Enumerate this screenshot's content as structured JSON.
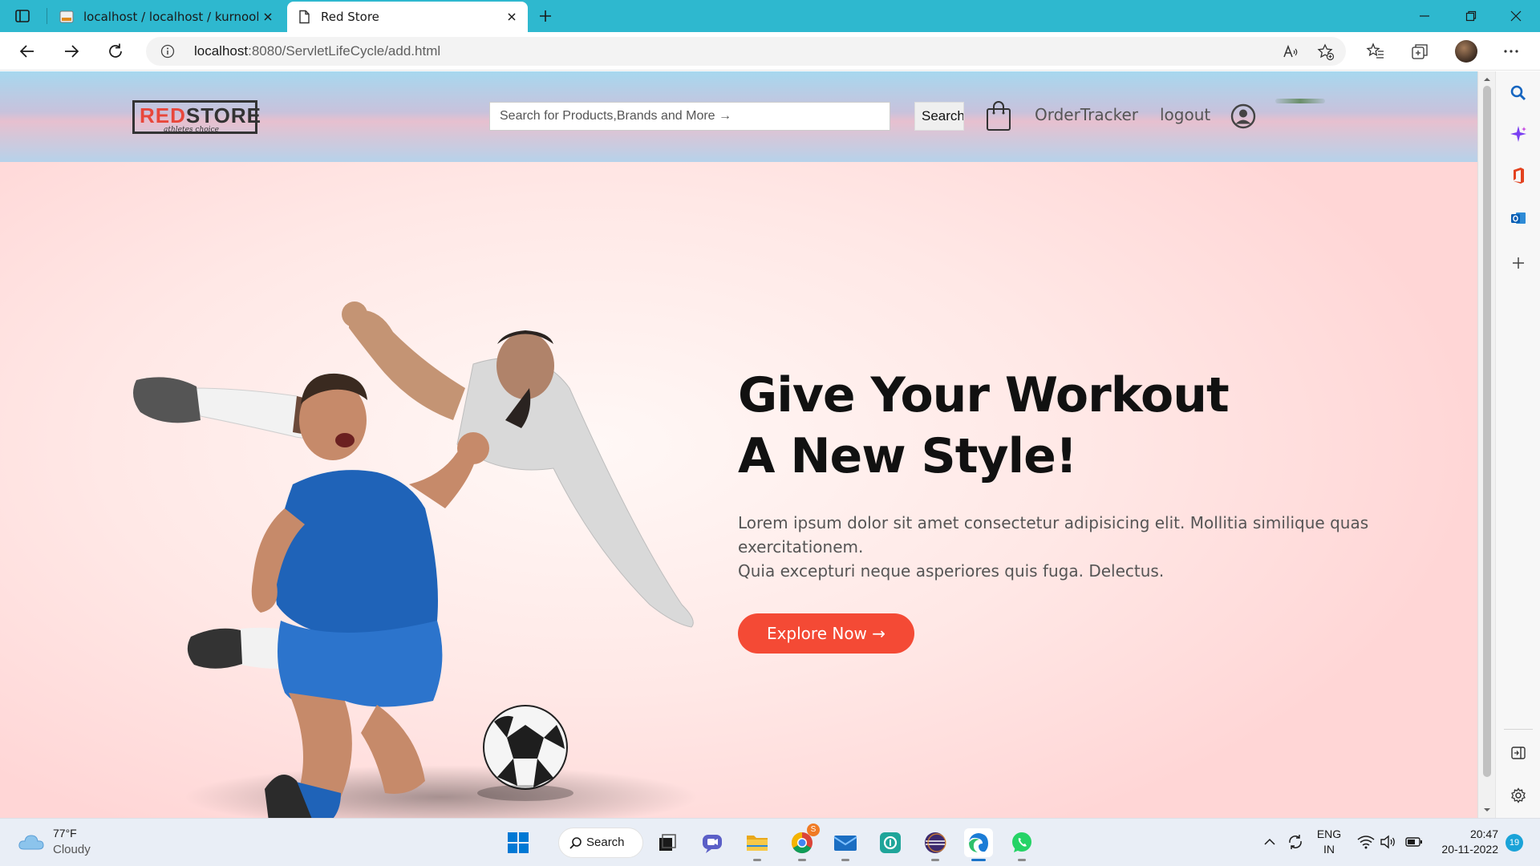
{
  "browser": {
    "tabs": [
      {
        "title": "localhost / localhost / kurnool / p",
        "active": false
      },
      {
        "title": "Red Store",
        "active": true
      }
    ],
    "address": {
      "host": "localhost",
      "path": ":8080/ServletLifeCycle/add.html"
    }
  },
  "site": {
    "logo": {
      "red": "RED",
      "dark": "STORE",
      "tagline": "athletes choice"
    },
    "search": {
      "placeholder": "Search for Products,Brands and More →",
      "button": "Search"
    },
    "nav": {
      "order_tracker": "OrderTracker",
      "logout": "logout"
    },
    "hero": {
      "title_line1": "Give Your Workout",
      "title_line2": "A New Style!",
      "text_line1": "Lorem ipsum dolor sit amet consectetur adipisicing elit. Mollitia similique quas",
      "text_line2": "exercitationem.",
      "text_line3": "Quia excepturi neque asperiores quis fuga. Delectus.",
      "cta": "Explore Now →"
    },
    "colors": {
      "accent": "#f44a35",
      "logo_red": "#e8473b"
    }
  },
  "taskbar": {
    "weather": {
      "temp": "77°F",
      "condition": "Cloudy"
    },
    "search_label": "Search",
    "chrome_badge": "S",
    "language": {
      "line1": "ENG",
      "line2": "IN"
    },
    "clock": {
      "time": "20:47",
      "date": "20-11-2022"
    },
    "notifications": "19"
  }
}
